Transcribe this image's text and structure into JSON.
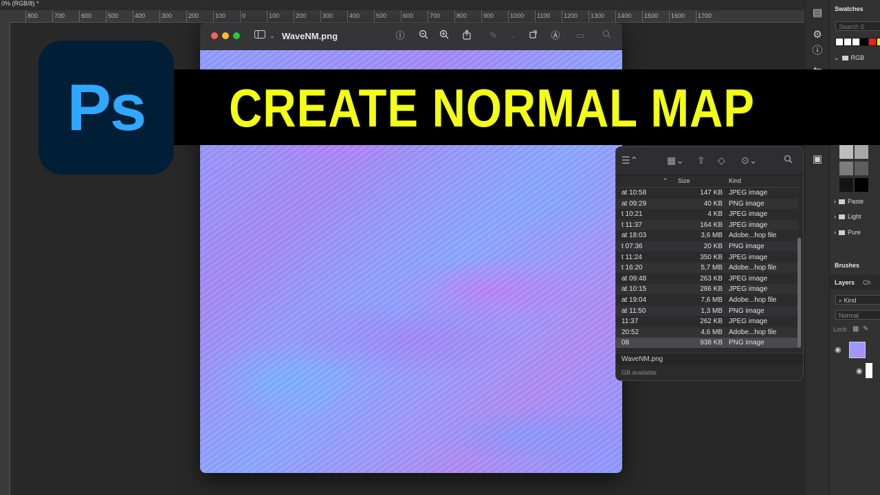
{
  "ps": {
    "doc_tab": "0% (RGB/8) *",
    "ruler_labels": [
      "800",
      "700",
      "600",
      "500",
      "400",
      "300",
      "200",
      "100",
      "0",
      "100",
      "200",
      "300",
      "400",
      "500",
      "600",
      "700",
      "800",
      "900",
      "1000",
      "1100",
      "1200",
      "1300",
      "1400",
      "1500",
      "1600",
      "1700"
    ],
    "logo_text": "Ps",
    "panels": {
      "swatches_tab": "Swatches",
      "swatches_search_placeholder": "Search S",
      "rgb_group": "RGB",
      "folders": [
        "Paste",
        "Light",
        "Pure"
      ],
      "brushes_tab": "Brushes",
      "layers_tab": "Layers",
      "channels_tab": "Ch",
      "kind_filter": "Kind",
      "blend_mode": "Normal",
      "lock_label": "Lock:"
    }
  },
  "title_banner": "CREATE NORMAL MAP",
  "preview": {
    "title": "WaveNM.png"
  },
  "finder": {
    "columns": {
      "size": "Size",
      "kind": "Kind"
    },
    "rows": [
      {
        "date": "at 10:58",
        "size": "147 KB",
        "kind": "JPEG image"
      },
      {
        "date": "at 09:29",
        "size": "40 KB",
        "kind": "PNG image"
      },
      {
        "date": "t 10:21",
        "size": "4 KB",
        "kind": "JPEG image"
      },
      {
        "date": "t 11:37",
        "size": "164 KB",
        "kind": "JPEG image"
      },
      {
        "date": "at 18:03",
        "size": "3,6 MB",
        "kind": "Adobe...hop file"
      },
      {
        "date": "t 07:36",
        "size": "20 KB",
        "kind": "PNG image"
      },
      {
        "date": "t 11:24",
        "size": "350 KB",
        "kind": "JPEG image"
      },
      {
        "date": "t 16:20",
        "size": "5,7 MB",
        "kind": "Adobe...hop file"
      },
      {
        "date": "at 09:48",
        "size": "263 KB",
        "kind": "JPEG image"
      },
      {
        "date": "at 10:15",
        "size": "286 KB",
        "kind": "JPEG image"
      },
      {
        "date": "at 19:04",
        "size": "7,6 MB",
        "kind": "Adobe...hop file"
      },
      {
        "date": "at 11:50",
        "size": "1,3 MB",
        "kind": "PNG image"
      },
      {
        "date": "11:37",
        "size": "262 KB",
        "kind": "JPEG image"
      },
      {
        "date": "20:52",
        "size": "4,6 MB",
        "kind": "Adobe...hop file"
      },
      {
        "date": "08",
        "size": "938 KB",
        "kind": "PNG image"
      }
    ],
    "path_item": "WaveNM.png",
    "status": "GB available"
  },
  "colors": {
    "ps_blue": "#31a8ff",
    "ps_dark": "#001e36",
    "banner_yellow": "#f2ff14"
  }
}
